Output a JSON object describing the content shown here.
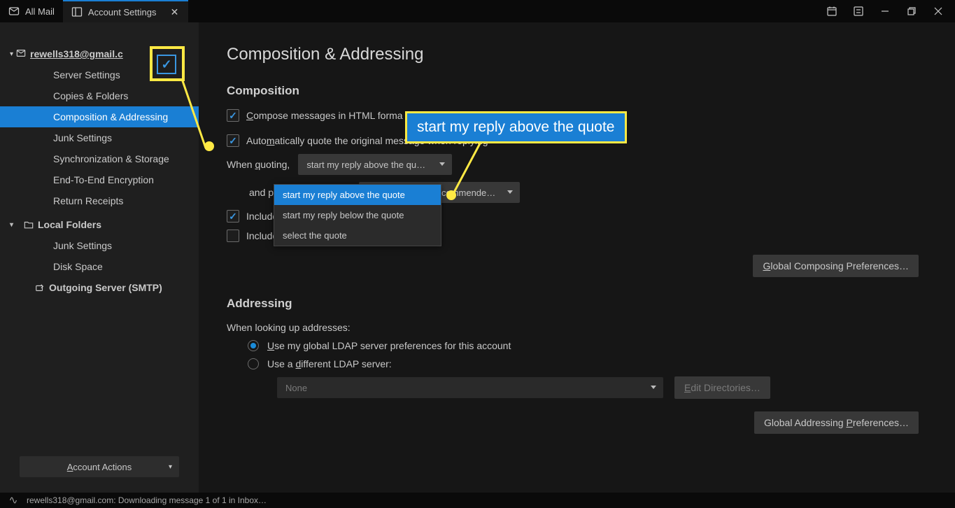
{
  "tabs": {
    "all_mail": "All Mail",
    "settings": "Account Settings"
  },
  "sidebar": {
    "account_email": "rewells318@gmail.c",
    "items": {
      "server_settings": "Server Settings",
      "copies_folders": "Copies & Folders",
      "composition_addressing": "Composition & Addressing",
      "junk_settings": "Junk Settings",
      "sync_storage": "Synchronization & Storage",
      "e2e_encryption": "End-To-End Encryption",
      "return_receipts": "Return Receipts"
    },
    "local_folders": "Local Folders",
    "lf_items": {
      "junk_settings": "Junk Settings",
      "disk_space": "Disk Space"
    },
    "outgoing": "Outgoing Server (SMTP)",
    "account_actions": "Account Actions"
  },
  "content": {
    "page_title": "Composition & Addressing",
    "composition_heading": "Composition",
    "compose_html": "Compose messages in HTML forma",
    "auto_quote": "Automatically quote the original message when replying",
    "when_quoting": "When quoting,",
    "quote_select": "start my reply above the qu…",
    "and_place": "and place my signature",
    "sig_select": "below my reply (recommende…",
    "include_sig_replies": "Include sig",
    "include_sig_forwards": "Include signature for forwards",
    "global_composing": "Global Composing Preferences…",
    "addressing_heading": "Addressing",
    "lookup_text": "When looking up addresses:",
    "use_global_ldap": "Use my global LDAP server preferences for this account",
    "use_diff_ldap": "Use a different LDAP server:",
    "ldap_select": "None",
    "edit_dirs": "Edit Directories…",
    "global_addressing": "Global Addressing Preferences…"
  },
  "dropdown": {
    "opt1": "start my reply above the quote",
    "opt2": "start my reply below the quote",
    "opt3": "select the quote"
  },
  "callout": {
    "tooltip": "start my reply above the quote"
  },
  "statusbar": {
    "text": "rewells318@gmail.com: Downloading message 1 of 1 in Inbox…"
  }
}
